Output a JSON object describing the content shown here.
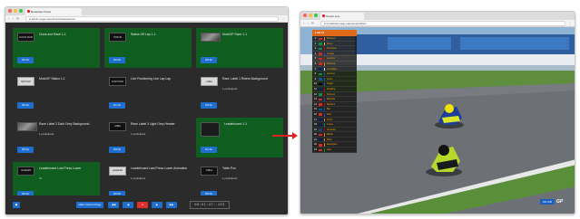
{
  "left_window": {
    "tab_title": "Broadcast Panel",
    "url": "● admin.page.panel/control/sequence/",
    "nav_glyphs": "‹ › ⟳",
    "menu_glyph": "⋮",
    "cards": [
      {
        "title": "Clock and Race 1-1",
        "subtitle": "",
        "button": "Off Air",
        "active": true,
        "thumb": "CLOCK 00:00",
        "thumb_style": "dark"
      },
      {
        "title": "Status Off Lap 1-1",
        "subtitle": "",
        "button": "Off Air",
        "active": true,
        "thumb": "STATUS",
        "thumb_style": "dark"
      },
      {
        "title": "MotoGP Race 1-1",
        "subtitle": "",
        "button": "Off Air",
        "active": true,
        "thumb": "",
        "thumb_style": "image"
      },
      {
        "title": "MotoGP Status 1-1",
        "subtitle": "",
        "button": "Off Air",
        "active": false,
        "thumb": "MOTOGP",
        "thumb_style": "light"
      },
      {
        "title": "Live Positioning Live Lap Lap",
        "subtitle": "",
        "button": "On Air",
        "active": false,
        "thumb": "POSITIONS",
        "thumb_style": "dark"
      },
      {
        "title": "Race Label 1 Riders Background",
        "subtitle": "1 participant",
        "button": "Off Air",
        "active": false,
        "thumb": "LABEL",
        "thumb_style": "light"
      },
      {
        "title": "Race Label 2 Dark Grey Background",
        "subtitle": "1 participant",
        "button": "Off Air",
        "active": false,
        "thumb": "",
        "thumb_style": "image"
      },
      {
        "title": "Race Label 3 Light Grey Header",
        "subtitle": "1 participant",
        "button": "Off Air",
        "active": false,
        "thumb": "LABEL",
        "thumb_style": "dark"
      },
      {
        "title": "Leaderboard 1-1",
        "subtitle": "",
        "button": "On Air",
        "active": true,
        "thumb": "",
        "thumb_style": "tall"
      },
      {
        "title": "Leaderboard Last Press Lower",
        "subtitle": "2x",
        "button": "Off Air",
        "active": true,
        "thumb": "LEADERS",
        "thumb_style": "dark"
      },
      {
        "title": "Leaderboard Last Press Lower Animation",
        "subtitle": "1 participant",
        "button": "Off Air",
        "active": false,
        "thumb": "LEADERS",
        "thumb_style": "light"
      },
      {
        "title": "Table Pos",
        "subtitle": "1 participant",
        "button": "Off Air",
        "active": false,
        "thumb": "TABLE",
        "thumb_style": "dark"
      }
    ],
    "bottom_bar": {
      "left_button": "◼",
      "main_button": "Hide Current Page",
      "small_buttons": [
        "◀◀",
        "◀",
        "●",
        "▶",
        "▶▶"
      ],
      "timecode": "00:01:47:.453"
    }
  },
  "right_window": {
    "tab_title": "Output Live",
    "url": "● broadcast.page.panel/output/live/",
    "nav_glyphs": "‹ › ⟳",
    "menu_glyph": "⋮",
    "standings_header": "LAP 10",
    "standings": [
      {
        "pos": "1",
        "name": "Marquez",
        "flag": "#d52b1e",
        "team": "#ff7a00"
      },
      {
        "pos": "2",
        "name": "Rossi",
        "flag": "#009246",
        "team": "#f7d117"
      },
      {
        "pos": "3",
        "name": "Dovizioso",
        "flag": "#009246",
        "team": "#cc0000"
      },
      {
        "pos": "4",
        "name": "Vinales",
        "flag": "#d52b1e",
        "team": "#1a4fd1"
      },
      {
        "pos": "5",
        "name": "Lorenzo",
        "flag": "#d52b1e",
        "team": "#cc0000"
      },
      {
        "pos": "6",
        "name": "Pedrosa",
        "flag": "#d52b1e",
        "team": "#ff7a00"
      },
      {
        "pos": "7",
        "name": "Crutchlow",
        "flag": "#012169",
        "team": "#ffffff"
      },
      {
        "pos": "8",
        "name": "Iannone",
        "flag": "#009246",
        "team": "#1a4fd1"
      },
      {
        "pos": "9",
        "name": "Zarco",
        "flag": "#0055a4",
        "team": "#1a4fd1"
      },
      {
        "pos": "10",
        "name": "Folger",
        "flag": "#000000",
        "team": "#1a4fd1"
      },
      {
        "pos": "11",
        "name": "Redding",
        "flag": "#012169",
        "team": "#cc0000"
      },
      {
        "pos": "12",
        "name": "Petrucci",
        "flag": "#009246",
        "team": "#cc0000"
      },
      {
        "pos": "13",
        "name": "Bautista",
        "flag": "#d52b1e",
        "team": "#1a4fd1"
      },
      {
        "pos": "14",
        "name": "Barbera",
        "flag": "#d52b1e",
        "team": "#cc0000"
      },
      {
        "pos": "15",
        "name": "Baz",
        "flag": "#0055a4",
        "team": "#1a4fd1"
      },
      {
        "pos": "16",
        "name": "Rins",
        "flag": "#d52b1e",
        "team": "#1a4fd1"
      },
      {
        "pos": "17",
        "name": "Smith",
        "flag": "#012169",
        "team": "#ff7a00"
      },
      {
        "pos": "18",
        "name": "Lowes",
        "flag": "#012169",
        "team": "#009246"
      },
      {
        "pos": "19",
        "name": "Abraham",
        "flag": "#11457e",
        "team": "#cc0000"
      },
      {
        "pos": "20",
        "name": "Rabat",
        "flag": "#d52b1e",
        "team": "#ff7a00"
      },
      {
        "pos": "21",
        "name": "Miller",
        "flag": "#012169",
        "team": "#ff7a00"
      },
      {
        "pos": "22",
        "name": "Espargaro",
        "flag": "#d52b1e",
        "team": "#ff7a00"
      },
      {
        "pos": "23",
        "name": "Aleix",
        "flag": "#d52b1e",
        "team": "#009246"
      }
    ],
    "live_tag": "ON AIR",
    "logo": "GP"
  },
  "colors": {
    "active_card": "#0f5e1f",
    "button_blue": "#1f6fd1",
    "arrow_red": "#e02020"
  }
}
